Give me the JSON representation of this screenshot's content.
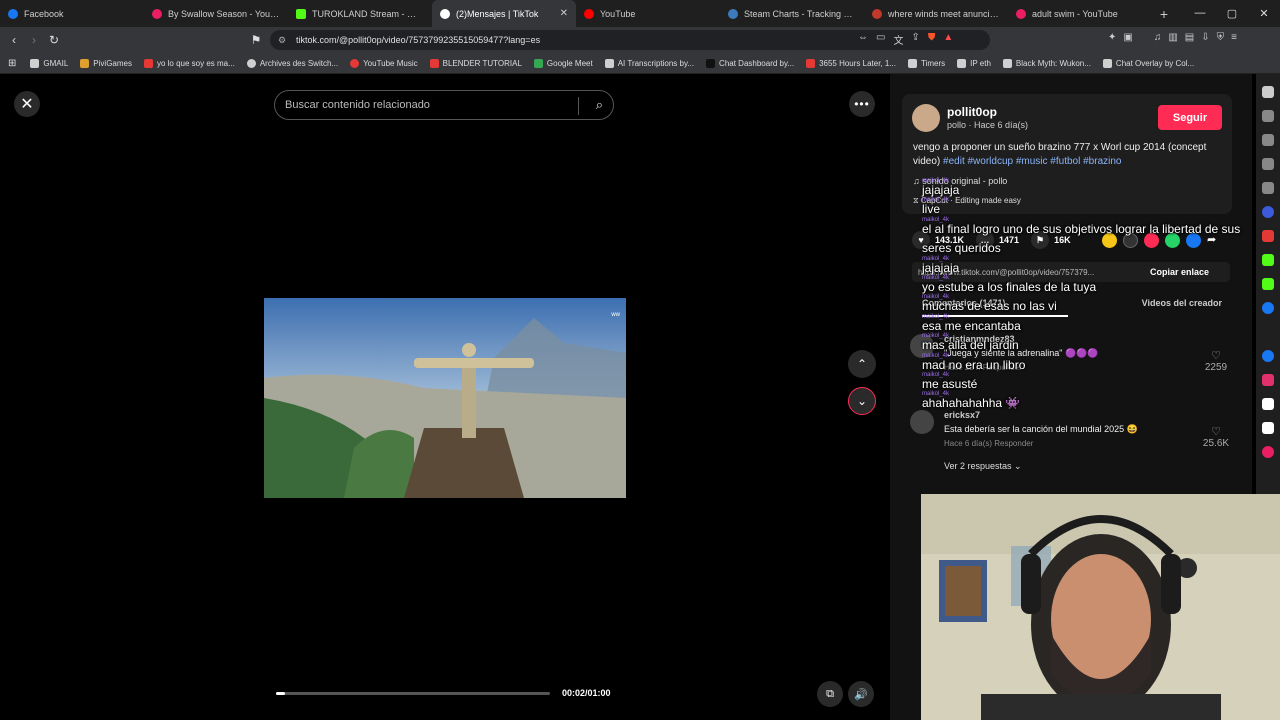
{
  "browser": {
    "tabs": [
      {
        "label": "Facebook",
        "color": "#1877f2"
      },
      {
        "label": "By Swallow Season - YouTube",
        "color": "#e91e63"
      },
      {
        "label": "TUROKLAND Stream - Watch L",
        "color": "#53fc18"
      },
      {
        "label": "(2)Mensajes | TikTok",
        "color": "#ffffff",
        "active": true
      },
      {
        "label": "YouTube",
        "color": "#ff0000"
      },
      {
        "label": "Steam Charts - Tracking What",
        "color": "#3d7bbf"
      },
      {
        "label": "where winds meet anuncio pa",
        "color": "#c0392b"
      },
      {
        "label": "adult swim - YouTube",
        "color": "#e91e63"
      }
    ],
    "url": "tiktok.com/@pollit0op/video/7573799235515059477?lang=es",
    "bookmarks": [
      {
        "label": "GMAIL",
        "color": "#cfcfcf"
      },
      {
        "label": "PiviGames",
        "color": "#e0a030"
      },
      {
        "label": "yo lo que soy es ma...",
        "color": "#e53935"
      },
      {
        "label": "Archives des Switch...",
        "color": "#cfcfcf"
      },
      {
        "label": "YouTube Music",
        "color": "#e53935"
      },
      {
        "label": "BLENDER TUTORIAL",
        "color": "#e53935"
      },
      {
        "label": "Google Meet",
        "color": "#34a853"
      },
      {
        "label": "AI Transcriptions by...",
        "color": "#cfcfcf"
      },
      {
        "label": "Chat Dashboard by...",
        "color": "#333333"
      },
      {
        "label": "3655 Hours Later, 1...",
        "color": "#e53935"
      },
      {
        "label": "Timers",
        "color": "#cfcfcf"
      },
      {
        "label": "IP eth",
        "color": "#cfcfcf"
      },
      {
        "label": "Black Myth: Wukon...",
        "color": "#cfcfcf"
      },
      {
        "label": "Chat Overlay by Col...",
        "color": "#cfcfcf"
      }
    ]
  },
  "video": {
    "search_placeholder": "Buscar contenido relacionado",
    "time": "00:02/01:00",
    "progress_fraction": 0.033
  },
  "post": {
    "author": "pollit0op",
    "author_sub": "pollo · Hace 6 día(s)",
    "follow_label": "Seguir",
    "caption_text": "vengo a proponer un sueño brazino 777 x Worl cup 2014 (concept video)",
    "hashtags": "#edit #worldcup #music #futbol #brazino",
    "sound": "sonido original - pollo",
    "capcut": "CapCut · Editing made easy",
    "likes": "143.1K",
    "comments": "1471",
    "saves": "16K",
    "share_url": "https://www.tiktok.com/@pollit0op/video/757379...",
    "copy_label": "Copiar enlace",
    "tab_comments": "Comentarios (1471)",
    "tab_creator": "Videos del creador"
  },
  "comments_list": [
    {
      "user": "cristianmndez83",
      "text": "\"Juega y siente la adrenalina\" 🟣🟣🟣",
      "meta": "Hace 22 h    Responder",
      "likes": "2259"
    },
    {
      "user": "ericksx7",
      "text": "Esta debería ser la canción del mundial 2025 😆",
      "meta": "Hace 6 día(s)    Responder",
      "likes": "25.6K"
    },
    {
      "user": "",
      "text": "Ver 2 respuestas ⌄",
      "meta": "",
      "likes": ""
    }
  ],
  "chat": [
    {
      "user": "maikol_4k",
      "msg": "jajajaja"
    },
    {
      "user": "maikol_4k",
      "msg": "live"
    },
    {
      "user": "maikol_4k",
      "msg": "el al final logro uno de sus objetivos lograr la libertad de sus"
    },
    {
      "user": "",
      "msg": "seres queridos"
    },
    {
      "user": "maikol_4k",
      "msg": "jajajaja"
    },
    {
      "user": "maikol_4k",
      "msg": "yo estube a los finales de la tuya"
    },
    {
      "user": "maikol_4k",
      "msg": "muchas de esas no las vi"
    },
    {
      "user": "maikol_4k",
      "msg": "esa me encantaba"
    },
    {
      "user": "maikol_4k",
      "msg": "mas alla del jardin"
    },
    {
      "user": "maikol_4k",
      "msg": "mad no era un libro"
    },
    {
      "user": "maikol_4k",
      "msg": "me asusté"
    },
    {
      "user": "maikol_4k",
      "msg": "ahahahahahha 👾"
    }
  ],
  "colors": {
    "accent": "#fe2c55",
    "hashtag": "#8ab4f8",
    "chat_user": "#9b6ee8"
  }
}
